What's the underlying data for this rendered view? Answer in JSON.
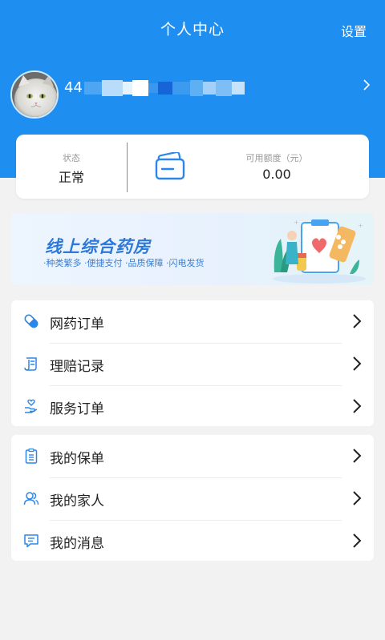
{
  "header": {
    "title": "个人中心",
    "settings_label": "设置"
  },
  "profile": {
    "id_prefix": "44"
  },
  "account": {
    "status_label": "状态",
    "status_value": "正常",
    "credit_label": "可用额度（元）",
    "credit_value": "0.00"
  },
  "banner": {
    "title": "线上综合药房",
    "subtitle": "·种类繁多 ·便捷支付 ·品质保障 ·闪电发货"
  },
  "menu_group_1": [
    {
      "label": "网药订单",
      "icon": "capsule-icon"
    },
    {
      "label": "理赔记录",
      "icon": "scroll-icon"
    },
    {
      "label": "服务订单",
      "icon": "heart-hand-icon"
    }
  ],
  "menu_group_2": [
    {
      "label": "我的保单",
      "icon": "clipboard-icon"
    },
    {
      "label": "我的家人",
      "icon": "people-icon"
    },
    {
      "label": "我的消息",
      "icon": "message-icon"
    }
  ],
  "colors": {
    "primary": "#1e8ff0",
    "icon_blue": "#2c86e8",
    "background": "#f2f2f2"
  }
}
